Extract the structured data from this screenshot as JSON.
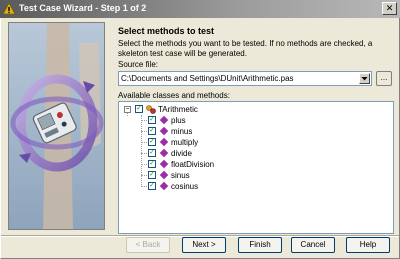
{
  "window": {
    "title": "Test Case Wizard - Step 1 of 2",
    "close_glyph": "✕"
  },
  "page": {
    "heading": "Select methods to test",
    "description": "Select the methods you want to be tested.  If no methods are checked, a skeleton test case will be generated."
  },
  "source": {
    "label": "Source file:",
    "value": "C:\\Documents and Settings\\DUnit\\Arithmetic.pas",
    "browse_label": "..."
  },
  "tree": {
    "label": "Available classes and methods:",
    "class_name": "TArithmetic",
    "class_checked": true,
    "expander": "−",
    "methods": [
      {
        "name": "plus",
        "checked": true
      },
      {
        "name": "minus",
        "checked": true
      },
      {
        "name": "multiply",
        "checked": true
      },
      {
        "name": "divide",
        "checked": true
      },
      {
        "name": "floatDivision",
        "checked": true
      },
      {
        "name": "sinus",
        "checked": true
      },
      {
        "name": "cosinus",
        "checked": true
      }
    ]
  },
  "buttons": {
    "back": "< Back",
    "next": "Next >",
    "finish": "Finish",
    "cancel": "Cancel",
    "help": "Help"
  },
  "colors": {
    "accent": "#003c74",
    "method_icon": "#9c2ca8"
  }
}
